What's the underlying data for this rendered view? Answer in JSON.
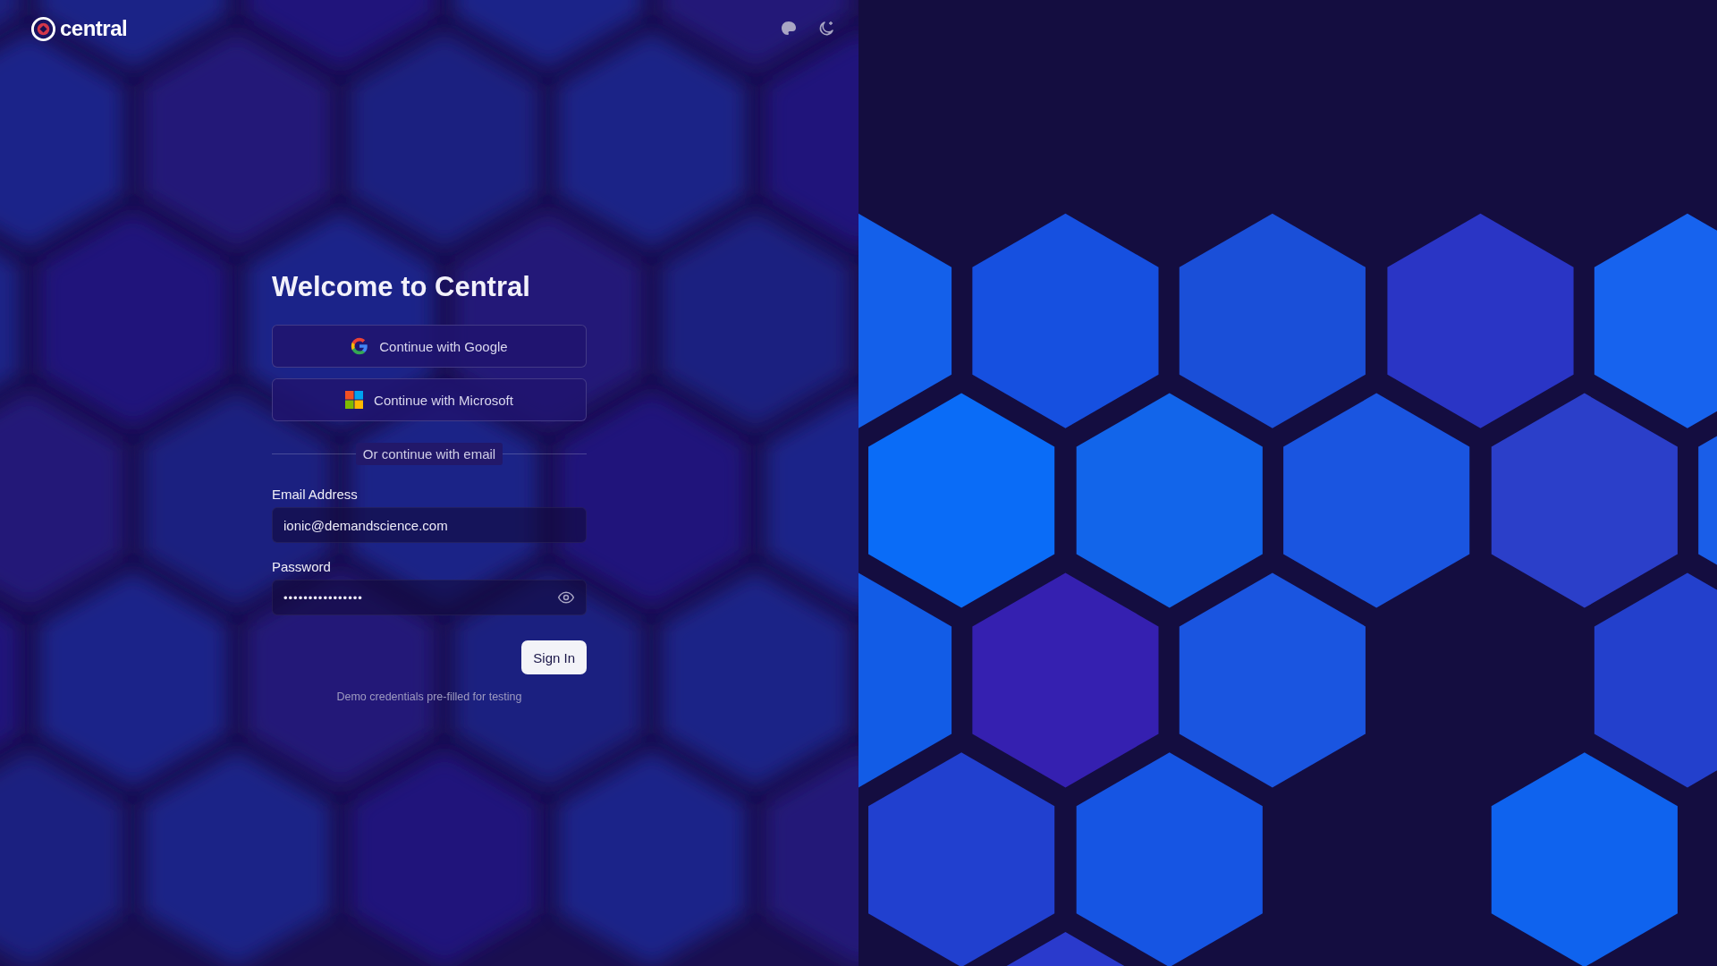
{
  "brand": {
    "name": "central"
  },
  "heading": "Welcome to Central",
  "sso_buttons": [
    {
      "kind": "google",
      "label": "Continue with Google"
    },
    {
      "kind": "microsoft",
      "label": "Continue with Microsoft"
    }
  ],
  "divider": "Or continue with email",
  "fields": [
    {
      "kind": "email",
      "label": "Email Address",
      "value": "ionic@demandscience.com"
    },
    {
      "kind": "password",
      "label": "Password",
      "value": "••••••••••••••••"
    }
  ],
  "submit": "Sign In",
  "note": "Demo credentials pre-filled for testing"
}
